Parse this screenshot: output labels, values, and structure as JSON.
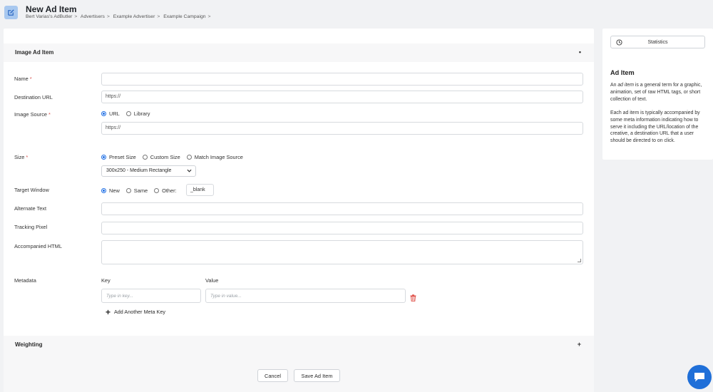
{
  "header": {
    "title": "New Ad Item",
    "breadcrumb": [
      "Bert Varias's AdButler",
      "Advertisers",
      "Example Advertiser",
      "Example Campaign"
    ],
    "separator": ">"
  },
  "section_image": {
    "title": "Image Ad Item",
    "toggle": "•"
  },
  "fields": {
    "name_label": "Name",
    "name_value": "",
    "destination_label": "Destination URL",
    "destination_value": "https://",
    "image_source_label": "Image Source",
    "image_source_options": [
      "URL",
      "Library"
    ],
    "image_source_selected": "URL",
    "image_source_value": "https://",
    "size_label": "Size",
    "size_options": [
      "Preset Size",
      "Custom Size",
      "Match Image Source"
    ],
    "size_selected": "Preset Size",
    "size_select_value": "300x250 - Medium Rectangle",
    "target_label": "Target Window",
    "target_options": [
      "New",
      "Same",
      "Other:"
    ],
    "target_selected": "New",
    "target_other_value": "_blank",
    "alt_label": "Alternate Text",
    "alt_value": "",
    "tracking_label": "Tracking Pixel",
    "tracking_value": "",
    "html_label": "Accompanied HTML",
    "html_value": "",
    "required_mark": "*"
  },
  "metadata": {
    "label": "Metadata",
    "key_header": "Key",
    "value_header": "Value",
    "key_placeholder": "Type in key...",
    "value_placeholder": "Type in value...",
    "add_label": "Add Another Meta Key"
  },
  "section_weighting": {
    "title": "Weighting",
    "toggle": "+"
  },
  "buttons": {
    "cancel": "Cancel",
    "save": "Save Ad Item"
  },
  "sidebar": {
    "stats_button": "Statistics",
    "title": "Ad Item",
    "p1_pre": "An ",
    "p1_em": "ad item",
    "p1_post": " is a general term for a graphic, animation, set of raw HTML tags, or short collection of text.",
    "p2": "Each ad item is typically accompanied by some meta information indicating how to serve it including the URL/location of the creative, a destination URL that a user should be directed to on click."
  },
  "colors": {
    "accent": "#1f6fe5",
    "chat": "#1f6fd8",
    "danger": "#e0554e",
    "logo_bg": "#a8c8ef"
  }
}
